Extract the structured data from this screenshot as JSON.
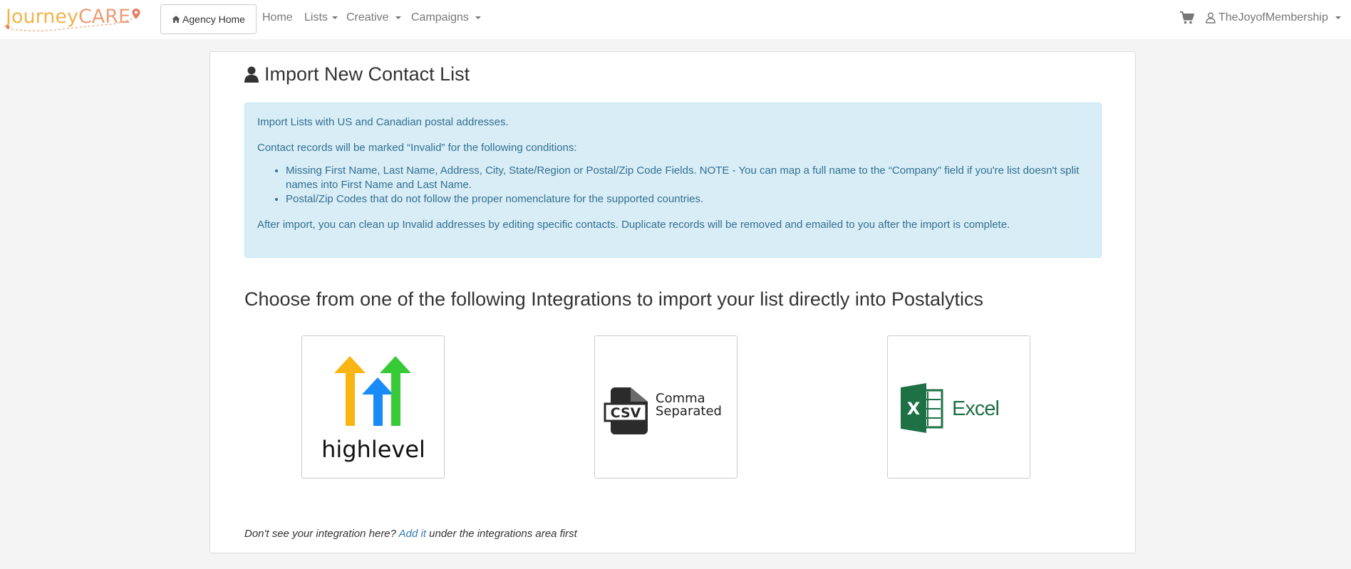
{
  "brand": {
    "logo_text_1": "Journey",
    "logo_text_2": "CARE"
  },
  "nav": {
    "agency_home": "Agency Home",
    "home": "Home",
    "lists": "Lists",
    "creative": "Creative",
    "campaigns": "Campaigns",
    "user": "TheJoyofMembership"
  },
  "page": {
    "title": "Import New Contact List",
    "alert": {
      "line1": "Import Lists with US and Canadian postal addresses.",
      "line2": "Contact records will be marked “Invalid” for the following conditions:",
      "bullets": [
        "Missing First Name, Last Name, Address, City, State/Region or Postal/Zip Code Fields. NOTE - You can map a full name to the “Company” field if you're list doesn't split names into First Name and Last Name.",
        "Postal/Zip Codes that do not follow the proper nomenclature for the supported countries."
      ],
      "line3": "After import, you can clean up Invalid addresses by editing specific contacts. Duplicate records will be removed and emailed to you after the import is complete."
    },
    "integrations_title": "Choose from one of the following Integrations to import your list directly into Postalytics",
    "integrations": [
      {
        "name": "highlevel",
        "label": "highlevel"
      },
      {
        "name": "csv",
        "badge": "CSV",
        "label_1": "Comma",
        "label_2": "Separated"
      },
      {
        "name": "excel",
        "badge": "X",
        "label": "Excel"
      }
    ],
    "footer": {
      "prefix": "Don't see your integration here?",
      "link": "Add it",
      "suffix": "under the integrations area first"
    }
  },
  "colors": {
    "alert_bg": "#d9edf7",
    "alert_text": "#31708f",
    "link": "#337ab7",
    "excel_green": "#1e7145",
    "hl_yellow": "#f9b511",
    "hl_blue": "#188bf6",
    "hl_green": "#37ca37"
  }
}
